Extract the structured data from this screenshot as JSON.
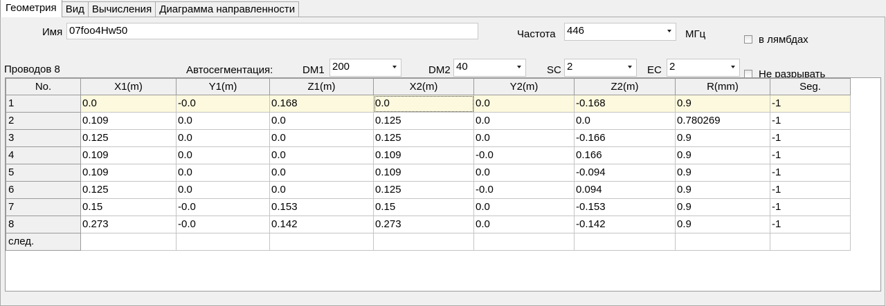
{
  "tabs": [
    {
      "label": "Геометрия",
      "active": true
    },
    {
      "label": "Вид",
      "active": false
    },
    {
      "label": "Вычисления",
      "active": false
    },
    {
      "label": "Диаграмма направленности",
      "active": false
    }
  ],
  "form": {
    "name_label": "Имя",
    "name_value": "07foo4Hw50",
    "freq_label": "Частота",
    "freq_value": "446",
    "freq_unit": "МГц",
    "lambda_label": "в лямбдах",
    "wires_label": "Проводов 8",
    "autoseg_label": "Автосегментация:",
    "dm1_label": "DM1",
    "dm1_value": "200",
    "dm2_label": "DM2",
    "dm2_value": "40",
    "sc_label": "SC",
    "sc_value": "2",
    "ec_label": "EC",
    "ec_value": "2",
    "nobreak_label": "Не разрывать"
  },
  "table": {
    "headers": [
      "No.",
      "X1(m)",
      "Y1(m)",
      "Z1(m)",
      "X2(m)",
      "Y2(m)",
      "Z2(m)",
      "R(mm)",
      "Seg."
    ],
    "rows": [
      [
        "1",
        "0.0",
        "-0.0",
        "0.168",
        "0.0",
        "0.0",
        "-0.168",
        "0.9",
        "-1"
      ],
      [
        "2",
        "0.109",
        "0.0",
        "0.0",
        "0.125",
        "0.0",
        "0.0",
        "0.780269",
        "-1"
      ],
      [
        "3",
        "0.125",
        "0.0",
        "0.0",
        "0.125",
        "0.0",
        "-0.166",
        "0.9",
        "-1"
      ],
      [
        "4",
        "0.109",
        "0.0",
        "0.0",
        "0.109",
        "-0.0",
        "0.166",
        "0.9",
        "-1"
      ],
      [
        "5",
        "0.109",
        "0.0",
        "0.0",
        "0.109",
        "0.0",
        "-0.094",
        "0.9",
        "-1"
      ],
      [
        "6",
        "0.125",
        "0.0",
        "0.0",
        "0.125",
        "-0.0",
        "0.094",
        "0.9",
        "-1"
      ],
      [
        "7",
        "0.15",
        "-0.0",
        "0.153",
        "0.15",
        "0.0",
        "-0.153",
        "0.9",
        "-1"
      ],
      [
        "8",
        "0.273",
        "-0.0",
        "0.142",
        "0.273",
        "0.0",
        "-0.142",
        "0.9",
        "-1"
      ]
    ],
    "next_label": "след.",
    "selected_row_color": "#fcf9de"
  }
}
